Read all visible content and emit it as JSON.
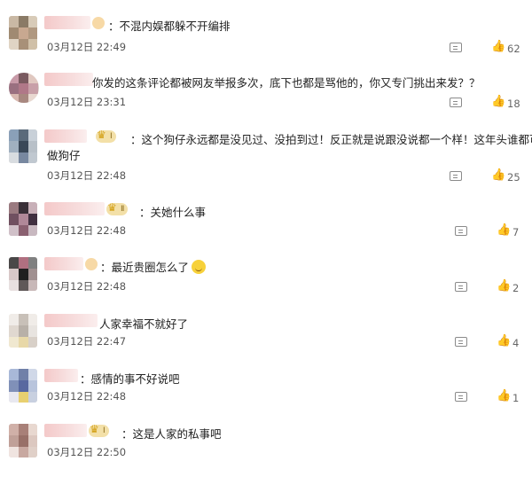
{
  "comments": [
    {
      "text": "：不混内娱都躲不开编排",
      "time": "03月12日 22:49",
      "likes": "62",
      "avatar": [
        "#c9b8a4",
        "#8a7a66",
        "#d8cbb8",
        "#a08a72"
      ],
      "badge": ""
    },
    {
      "text": "你发的这条评论都被网友举报多次，底下也都是骂他的，你又专门挑出来发？？",
      "time": "03月12日 23:31",
      "likes": "18",
      "avatar": [
        "#c89aa8",
        "#7a5a60",
        "#e0c8c0",
        "#9a7080"
      ],
      "badge": ""
    },
    {
      "text_line1": "：这个狗仔永远都是没见过、没拍到过！反正就是说跟没说都一个样！这年头谁都可以",
      "text_line2": "做狗仔",
      "time": "03月12日 22:48",
      "likes": "25",
      "avatar": [
        "#8aa0b8",
        "#5a6a7a",
        "#c8d0d8",
        "#a0b0c0"
      ],
      "badge": "Ⅰ"
    },
    {
      "text": "：关她什么事",
      "time": "03月12日 22:48",
      "likes": "7",
      "avatar": [
        "#9a7a80",
        "#3a3038",
        "#c8b0b8",
        "#705060"
      ],
      "badge": "Ⅱ"
    },
    {
      "text": "：最近贵圈怎么了",
      "time": "03月12日 22:48",
      "likes": "2",
      "avatar": [
        "#4a4848",
        "#b07080",
        "#808080",
        "#d8c8c8"
      ],
      "badge": ""
    },
    {
      "text": "人家幸福不就好了",
      "time": "03月12日 22:47",
      "likes": "4",
      "avatar": [
        "#e8e4e0",
        "#c8c0b8",
        "#d8d0c8",
        "#e8d8a8"
      ],
      "badge": ""
    },
    {
      "text": "：感情的事不好说吧",
      "time": "03月12日 22:48",
      "likes": "1",
      "avatar": [
        "#a8b8d8",
        "#7080a8",
        "#d0d8e8",
        "#e8d070"
      ],
      "badge": ""
    },
    {
      "text": "：这是人家的私事吧",
      "time": "03月12日 22:50",
      "likes": "",
      "avatar": [
        "#d0b0a8",
        "#a88078",
        "#e8d8d0",
        "#c0a098"
      ],
      "badge": "Ⅰ"
    }
  ]
}
